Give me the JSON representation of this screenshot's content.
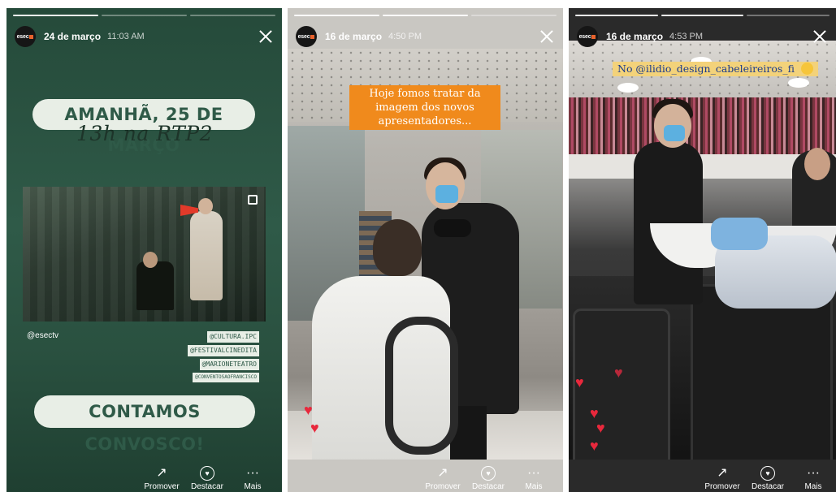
{
  "stories": [
    {
      "date": "24 de março",
      "time": "11:03 AM",
      "avatar_label": "esec",
      "headline": "AMANHÃ, 25 DE MARÇO",
      "subline": "13h na RTP2",
      "handle": "@esectv",
      "tags": [
        "@CULTURA.IPC",
        "@FESTIVALCINEDITA",
        "@MARIONETEATRO",
        "@CONVENTOSAOFRANCISCO"
      ],
      "closing": "CONTAMOS CONVOSCO!"
    },
    {
      "date": "16 de março",
      "time": "4:50 PM",
      "avatar_label": "esec",
      "caption": "Hoje fomos tratar da imagem dos novos apresentadores..."
    },
    {
      "date": "16 de março",
      "time": "4:53 PM",
      "avatar_label": "esec",
      "caption": "No @ilidio_design_cabeleireiros_fi"
    }
  ],
  "actions": {
    "promote": "Promover",
    "highlight": "Destacar",
    "more": "Mais"
  },
  "icons": {
    "promote": "trend-up-icon",
    "highlight": "heart-circle-icon",
    "more": "more-dots-icon",
    "close": "close-icon",
    "heart": "heart-icon"
  },
  "colors": {
    "story1_bg": "#2f5a48",
    "pill_bg": "#e8eee6",
    "caption2_bg": "#f08a1c",
    "caption3_bg": "#f3d27a",
    "heart": "#e8283c"
  }
}
